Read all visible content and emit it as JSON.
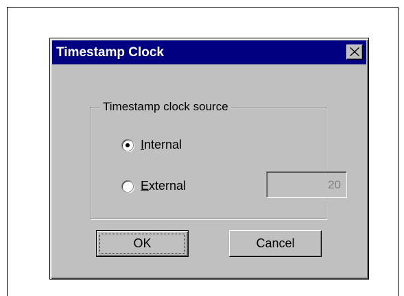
{
  "dialog": {
    "title": "Timestamp Clock",
    "close_icon": "close-x-icon"
  },
  "group": {
    "legend": "Timestamp clock source",
    "options": [
      {
        "label_mnemonic": "I",
        "label_rest": "nternal",
        "selected": true
      },
      {
        "label_mnemonic": "E",
        "label_rest": "xternal",
        "selected": false
      }
    ],
    "external_value": "20"
  },
  "buttons": {
    "ok_label": "OK",
    "cancel_label": "Cancel"
  },
  "colors": {
    "titlebar": "#000080",
    "face": "#c0c0c0"
  }
}
